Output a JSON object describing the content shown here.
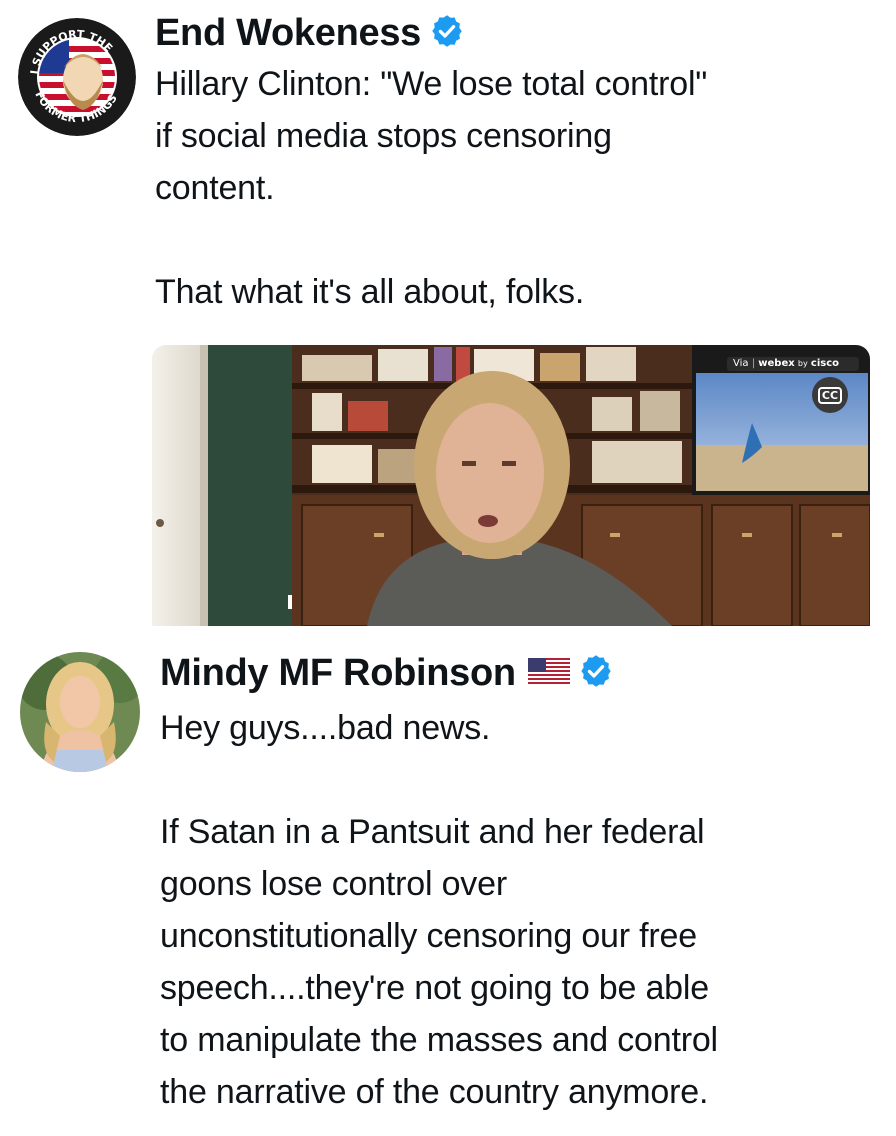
{
  "post1": {
    "author": "End Wokeness",
    "verified_color": "#1d9bf0",
    "avatar_text_top": "I SUPPORT THE",
    "avatar_text_bottom": "FORMER THINGS",
    "text": "Hillary Clinton: \"We lose total control\"\nif social media stops censoring\ncontent.\n\nThat what it's all about, folks.",
    "media": {
      "badge_via": "Via",
      "badge_brand": "webex",
      "badge_by": "by",
      "badge_company": "cisco",
      "cc_label": "CC"
    }
  },
  "post2": {
    "author": "Mindy MF Robinson",
    "flag_icon": "us-flag-icon",
    "verified_color": "#1d9bf0",
    "text": "Hey guys....bad news.\n\nIf Satan in a Pantsuit and her federal\ngoons lose control over\nunconstitutionally censoring our free\nspeech....they're not going to be able\nto manipulate the masses and control\nthe narrative of the country anymore."
  }
}
